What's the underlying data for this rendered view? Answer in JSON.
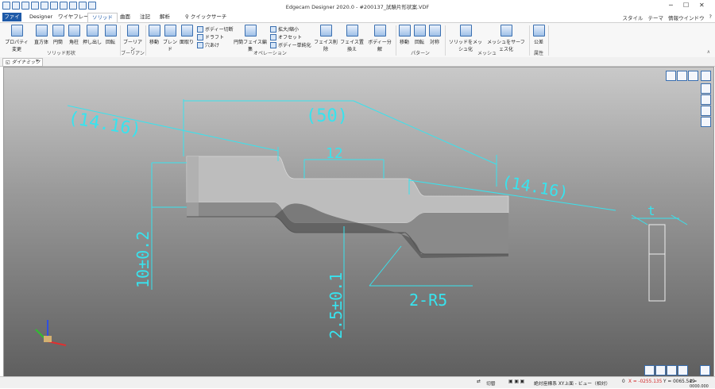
{
  "window": {
    "title": "Edgecam Designer 2020.0 - #200137_試験片形状案.VDF",
    "minimize": "─",
    "maximize": "☐",
    "close": "✕"
  },
  "tabs": {
    "file": "ファイル",
    "items": [
      "Designer",
      "ワイヤフレーム",
      "ソリッド",
      "曲面",
      "注記",
      "解析"
    ],
    "active": "ソリッド",
    "search": "クイックサーチ",
    "right": [
      "スタイル",
      "テーマ",
      "情報ウインドウ"
    ]
  },
  "ribbon": {
    "groups": [
      "ソリッド形状",
      "ブーリアン",
      "オペレーション",
      "パターン",
      "メッシュ",
      "属性"
    ],
    "buttons": {
      "property": "プロパティ変更",
      "box": "直方体",
      "cylinder": "円筒",
      "prism": "角柱",
      "extrude": "押し出し",
      "revolve": "回転",
      "boolean": "ブーリアン",
      "move": "移動",
      "blend": "ブレンド",
      "chamfer": "面取り",
      "body_cut": "ボディー切断",
      "draft": "ドラフト",
      "hole": "穴あけ",
      "cyl_face_edit": "円筒フェイス編集",
      "scale": "拡大/縮小",
      "offset": "オフセット",
      "body_simplify": "ボディー単純化",
      "face_delete": "フェイス削除",
      "face_replace": "フェイス置換え",
      "body_split": "ボディー分解",
      "p_move": "移動",
      "p_rotate": "回転",
      "p_mirror": "対称",
      "solid_to_mesh": "ソリッドをメッシュ化",
      "mesh_to_surface": "メッシュをサーフェス化",
      "publish": "公差"
    }
  },
  "doc_tab": "ダイナミック",
  "drawing": {
    "dim_left": "(14.16)",
    "dim_total": "(50)",
    "dim_center": "12",
    "dim_right": "(14.16)",
    "dim_height": "10±0.2",
    "dim_thick": "2.5±0.1",
    "dim_radius": "2-R5",
    "dim_t": "t"
  },
  "status": {
    "cut": "切替",
    "coord": "絶対座標系 XY上面 - ビュー（相対）",
    "zero": "0",
    "x": "X = -0255.135",
    "y": "Y = 0065.549",
    "z": "Z = 0000.000"
  }
}
